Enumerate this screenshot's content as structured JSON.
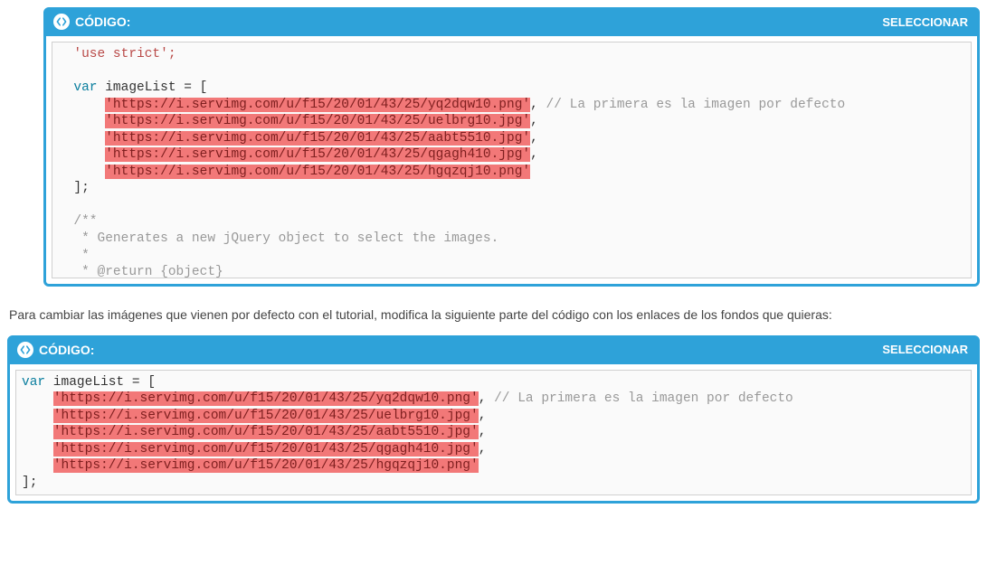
{
  "block1": {
    "header_title": "CÓDIGO:",
    "select_label": "SELECCIONAR",
    "code": {
      "l1": "  'use strict';",
      "l2": "",
      "l3_pre": "  ",
      "l3_var": "var",
      "l3_post": " imageList = [",
      "urls": [
        "'https://i.servimg.com/u/f15/20/01/43/25/yq2dqw10.png'",
        "'https://i.servimg.com/u/f15/20/01/43/25/uelbrg10.jpg'",
        "'https://i.servimg.com/u/f15/20/01/43/25/aabt5510.jpg'",
        "'https://i.servimg.com/u/f15/20/01/43/25/qgagh410.jpg'",
        "'https://i.servimg.com/u/f15/20/01/43/25/hgqzqj10.png'"
      ],
      "url_comment": " // La primera es la imagen por defecto",
      "close_arr": "  ];",
      "doc1": "  /**",
      "doc2": "   * Generates a new jQuery object to select the images.",
      "doc3": "   *",
      "doc4": "   * @return {object}"
    }
  },
  "paragraph": "Para cambiar las imágenes que vienen por defecto con el tutorial, modifica la siguiente parte del código con los enlaces de los fondos que quieras:",
  "block2": {
    "header_title": "CÓDIGO:",
    "select_label": "SELECCIONAR",
    "code": {
      "l1_var": "var",
      "l1_post": " imageList = [",
      "urls": [
        "'https://i.servimg.com/u/f15/20/01/43/25/yq2dqw10.png'",
        "'https://i.servimg.com/u/f15/20/01/43/25/uelbrg10.jpg'",
        "'https://i.servimg.com/u/f15/20/01/43/25/aabt5510.jpg'",
        "'https://i.servimg.com/u/f15/20/01/43/25/qgagh410.jpg'",
        "'https://i.servimg.com/u/f15/20/01/43/25/hgqzqj10.png'"
      ],
      "url_comment": " // La primera es la imagen por defecto",
      "close_arr": "];"
    }
  }
}
